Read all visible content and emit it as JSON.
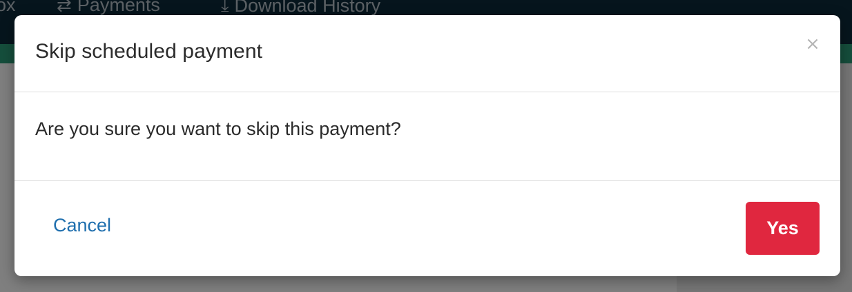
{
  "nav": {
    "items": [
      {
        "label": "ox",
        "icon": ""
      },
      {
        "label": "Payments",
        "icon": "transfer-arrows-icon"
      },
      {
        "label": "Download History",
        "icon": "download-icon"
      }
    ]
  },
  "modal": {
    "title": "Skip scheduled payment",
    "close_symbol": "×",
    "message": "Are you sure you want to skip this payment?",
    "cancel_label": "Cancel",
    "confirm_label": "Yes"
  },
  "colors": {
    "nav_bg": "#0d2a3a",
    "accent_green": "#2a9c78",
    "link_blue": "#1f6fae",
    "danger_red": "#e0273f"
  }
}
